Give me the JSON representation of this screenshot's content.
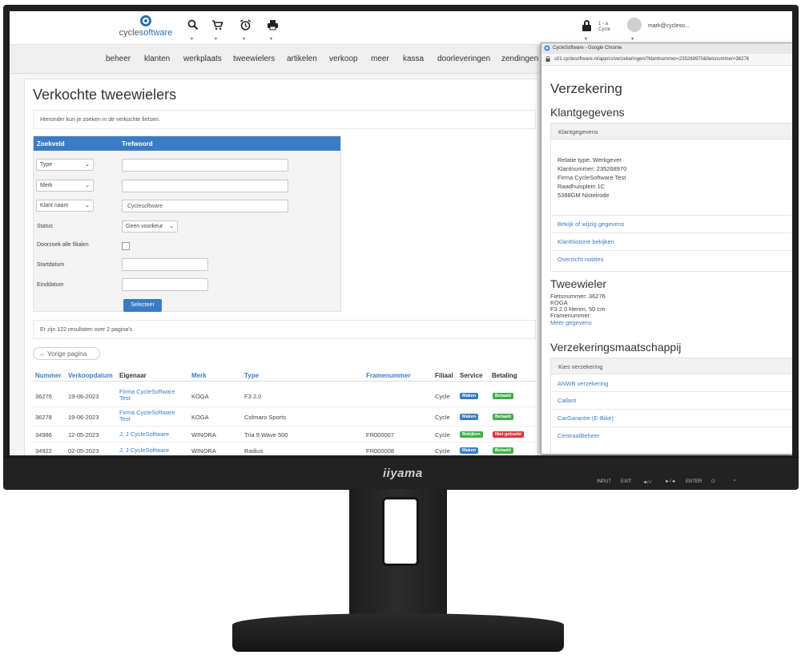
{
  "monitor": {
    "brand": "iiyama",
    "osd_buttons": [
      "INPUT",
      "EXIT",
      "◄/✓",
      "►/◄",
      "ENTER",
      "⏻"
    ]
  },
  "topbar": {
    "logo_text_a": "cycle",
    "logo_text_b": "software",
    "icons": [
      "search-icon",
      "cart-icon",
      "alarm-clock-icon",
      "printer-icon"
    ],
    "user_count_line1": "1 - a",
    "user_count_line2": "Cycle",
    "user_name": "mark@cycleso..."
  },
  "nav": {
    "items": [
      "beheer",
      "klanten",
      "werkplaats",
      "tweewielers",
      "artikelen",
      "verkoop",
      "meer",
      "kassa",
      "doorleveringen",
      "zendingen"
    ]
  },
  "page": {
    "title": "Verkochte tweewielers",
    "info": "Hieronder kun je zoeken in de verkochte fietsen.",
    "search": {
      "col_field": "Zoekveld",
      "col_term": "Trefwoord",
      "fields": [
        {
          "select": "Type",
          "value": ""
        },
        {
          "select": "Merk",
          "value": ""
        },
        {
          "select": "Klant naam",
          "value": "Cyclesoftware"
        }
      ],
      "status_label": "Status",
      "status_value": "Geen voorkeur",
      "all_branches_label": "Doorzoek alle filialen",
      "start_label": "Startdatum",
      "end_label": "Einddatum",
      "button": "Selecteer"
    },
    "results_text": "Er zijn 122 resultaten over 2 pagina's",
    "prev_page": "← Vorige pagina",
    "table": {
      "headers": [
        "Nummer",
        "Verkoopdatum",
        "Eigenaar",
        "Merk",
        "Type",
        "Framenummer",
        "Filiaal",
        "Service",
        "Betaling"
      ],
      "rows": [
        {
          "nummer": "36276",
          "datum": "19-06-2023",
          "eigenaar1": "Firma CycleSoftware",
          "eigenaar2": "Test",
          "merk": "KOGA",
          "type": "F3 2.0",
          "frame": "",
          "filiaal": "Cycle",
          "service": "Maken",
          "betaling": "Betaald"
        },
        {
          "nummer": "36278",
          "datum": "19-06-2023",
          "eigenaar1": "Firma CycleSoftware",
          "eigenaar2": "Test",
          "merk": "KOGA",
          "type": "Colmaro Sports",
          "frame": "",
          "filiaal": "Cycle",
          "service": "Maken",
          "betaling": "Betaald"
        },
        {
          "nummer": "34986",
          "datum": "12-05-2023",
          "eigenaar1": "J. J CycleSoftware",
          "eigenaar2": "",
          "merk": "WINORA",
          "type": "Tria 9 Wave 500",
          "frame": "FR000007",
          "filiaal": "Cycle",
          "service": "Bekijken",
          "betaling": "Niet geboekt"
        },
        {
          "nummer": "34922",
          "datum": "02-05-2023",
          "eigenaar1": "J. J CycleSoftware",
          "eigenaar2": "",
          "merk": "WINORA",
          "type": "Radius",
          "frame": "FR000008",
          "filiaal": "Cycle",
          "service": "Maken",
          "betaling": "Betaald"
        }
      ]
    }
  },
  "popup": {
    "window_title": "CycleSoftware - Google Chrome",
    "url": "s01.cyclesoftware.nl/app/cs/verzekeringen/?klantnummer=235268970&fietsnummer=36276",
    "title": "Verzekering",
    "klant_heading": "Klantgegevens",
    "klant_panel_title": "Klantgegevens",
    "klant_lines": [
      "Relatie type: Werkgever",
      "Klantnummer: 235268970",
      "Firma CycleSoftware Test",
      "Raadhuisplein 1C",
      "5388GM Nistelrode"
    ],
    "klant_links": [
      "Bekijk of wijzig gegevens",
      "Klanthistorie bekijken",
      "Overzicht notities"
    ],
    "bike_heading": "Tweewieler",
    "bike_lines": [
      "Fietsnummer: 36276",
      "KOGA",
      "F3 2.0 Heren, 50 cm",
      "Framenummer:"
    ],
    "bike_more": "Meer gegevens",
    "insurer_heading": "Verzekeringsmaatschappij",
    "insurer_panel_title": "Kies verzekering",
    "insurers": [
      "ANWB verzekering",
      "Callant",
      "CarGarantie (E-Bike)",
      "CentraalBeheer"
    ]
  },
  "colors": {
    "accent": "#3a7cc3",
    "badge_blue": "#3a7cc3",
    "badge_green": "#3fae49",
    "badge_red": "#d9363e"
  }
}
